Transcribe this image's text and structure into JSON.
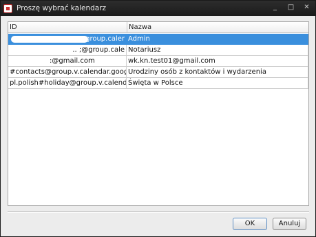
{
  "window": {
    "title": "Proszę wybrać kalendarz",
    "controls": [
      "_",
      "□",
      "✕"
    ]
  },
  "table": {
    "columns": [
      "ID",
      "Nazwa"
    ],
    "rows": [
      {
        "id": "@group.caler",
        "name": "Admin",
        "selected": true
      },
      {
        "id": "..   ;@group.cale",
        "name": "Notariusz",
        "selected": false
      },
      {
        "id": ":@gmail.com",
        "name": "wk.kn.test01@gmail.com",
        "selected": false
      },
      {
        "id": "#contacts@group.v.calendar.google.com",
        "name": "Urodziny osób z kontaktów i wydarzenia",
        "selected": false
      },
      {
        "id": "pl.polish#holiday@group.v.calendar.goog",
        "name": "Święta w Polsce",
        "selected": false
      }
    ]
  },
  "buttons": {
    "ok": "OK",
    "cancel": "Anuluj"
  },
  "colors": {
    "selection": "#3a8fdd",
    "titlebar": "#1b1b1b"
  }
}
